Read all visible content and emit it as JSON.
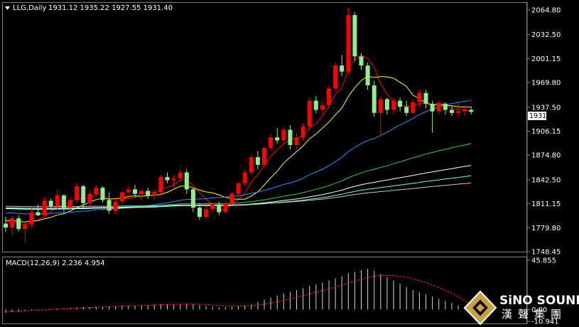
{
  "chart_data": {
    "type": "candlestick",
    "header": {
      "symbol": "LLG,Daily",
      "ohlc": "1931.12 1935.22 1927.55 1931.40"
    },
    "y_ticks": [
      "2064.80",
      "2032.50",
      "2001.15",
      "1969.80",
      "1937.50",
      "1906.15",
      "1874.80",
      "1842.50",
      "1811.15",
      "1779.80",
      "1748.45"
    ],
    "ylim": [
      1748.45,
      2074
    ],
    "current_price": "1931.40",
    "colors": {
      "up": "#ff0000",
      "down": "#90ee90",
      "ma_fast": "#ff0000",
      "ma_2": "#ffff00",
      "ma_3": "#1e90ff",
      "ma_4": "#2ecc40",
      "ma_5": "#ffffff",
      "ma_6": "#d8bfd8",
      "ma_7": "#7fffd4"
    },
    "candles": [
      [
        1785,
        1794,
        1774,
        1780
      ],
      [
        1780,
        1795,
        1770,
        1792
      ],
      [
        1792,
        1796,
        1775,
        1778
      ],
      [
        1778,
        1787,
        1760,
        1784
      ],
      [
        1784,
        1805,
        1780,
        1800
      ],
      [
        1800,
        1810,
        1795,
        1796
      ],
      [
        1796,
        1820,
        1794,
        1815
      ],
      [
        1815,
        1818,
        1805,
        1808
      ],
      [
        1808,
        1830,
        1804,
        1822
      ],
      [
        1822,
        1824,
        1800,
        1806
      ],
      [
        1806,
        1820,
        1802,
        1816
      ],
      [
        1816,
        1838,
        1812,
        1834
      ],
      [
        1834,
        1836,
        1806,
        1812
      ],
      [
        1812,
        1828,
        1808,
        1824
      ],
      [
        1824,
        1836,
        1820,
        1832
      ],
      [
        1832,
        1834,
        1813,
        1816
      ],
      [
        1816,
        1826,
        1798,
        1802
      ],
      [
        1802,
        1818,
        1798,
        1814
      ],
      [
        1814,
        1828,
        1810,
        1826
      ],
      [
        1826,
        1835,
        1818,
        1830
      ],
      [
        1830,
        1836,
        1820,
        1824
      ],
      [
        1824,
        1830,
        1815,
        1828
      ],
      [
        1828,
        1832,
        1818,
        1822
      ],
      [
        1822,
        1830,
        1816,
        1826
      ],
      [
        1826,
        1848,
        1822,
        1846
      ],
      [
        1846,
        1852,
        1838,
        1842
      ],
      [
        1842,
        1848,
        1832,
        1844
      ],
      [
        1844,
        1856,
        1840,
        1852
      ],
      [
        1852,
        1856,
        1824,
        1830
      ],
      [
        1830,
        1832,
        1800,
        1806
      ],
      [
        1806,
        1812,
        1790,
        1794
      ],
      [
        1794,
        1808,
        1790,
        1804
      ],
      [
        1804,
        1812,
        1798,
        1810
      ],
      [
        1810,
        1814,
        1796,
        1800
      ],
      [
        1800,
        1816,
        1798,
        1812
      ],
      [
        1812,
        1826,
        1810,
        1824
      ],
      [
        1824,
        1840,
        1820,
        1838
      ],
      [
        1838,
        1856,
        1834,
        1852
      ],
      [
        1852,
        1876,
        1848,
        1872
      ],
      [
        1872,
        1880,
        1856,
        1862
      ],
      [
        1862,
        1886,
        1858,
        1884
      ],
      [
        1884,
        1902,
        1880,
        1898
      ],
      [
        1898,
        1910,
        1890,
        1894
      ],
      [
        1894,
        1912,
        1888,
        1908
      ],
      [
        1908,
        1914,
        1882,
        1888
      ],
      [
        1888,
        1904,
        1882,
        1898
      ],
      [
        1898,
        1916,
        1894,
        1912
      ],
      [
        1912,
        1950,
        1906,
        1946
      ],
      [
        1946,
        1952,
        1930,
        1934
      ],
      [
        1934,
        1946,
        1928,
        1940
      ],
      [
        1940,
        1966,
        1936,
        1962
      ],
      [
        1962,
        1996,
        1958,
        1992
      ],
      [
        1992,
        2006,
        1978,
        1984
      ],
      [
        1984,
        2068,
        1980,
        2058
      ],
      [
        2058,
        2062,
        1998,
        2004
      ],
      [
        2004,
        2008,
        1986,
        1992
      ],
      [
        1992,
        1996,
        1960,
        1966
      ],
      [
        1966,
        1972,
        1925,
        1930
      ],
      [
        1930,
        1952,
        1900,
        1948
      ],
      [
        1948,
        1950,
        1928,
        1934
      ],
      [
        1934,
        1950,
        1928,
        1946
      ],
      [
        1946,
        1950,
        1932,
        1938
      ],
      [
        1938,
        1946,
        1926,
        1930
      ],
      [
        1930,
        1948,
        1928,
        1944
      ],
      [
        1944,
        1960,
        1938,
        1956
      ],
      [
        1956,
        1960,
        1936,
        1942
      ],
      [
        1942,
        1946,
        1904,
        1932
      ],
      [
        1932,
        1946,
        1928,
        1942
      ],
      [
        1942,
        1944,
        1928,
        1934
      ],
      [
        1934,
        1940,
        1926,
        1930
      ],
      [
        1930,
        1945,
        1925,
        1932
      ],
      [
        1932,
        1940,
        1926,
        1934
      ],
      [
        1934,
        1938,
        1928,
        1931.4
      ]
    ],
    "macd": {
      "label": "MACD(12,26,9) 2.236 4.954",
      "y_ticks": [
        "45.855",
        "0.00",
        "-10.941"
      ],
      "ylim": [
        -10.941,
        45.855
      ],
      "histogram": [
        -3,
        -2.5,
        -2,
        -1.5,
        -1,
        -0.5,
        0,
        0.5,
        1,
        1.2,
        1.5,
        2,
        2.2,
        2.4,
        2.6,
        2.8,
        3,
        3.2,
        3.4,
        3.6,
        3.8,
        4,
        4.2,
        4.5,
        4.8,
        5,
        5.2,
        5.4,
        5.6,
        5.2,
        4.2,
        3.2,
        2.6,
        2.2,
        2.2,
        2.6,
        3.2,
        4,
        5,
        7,
        9,
        11,
        13,
        15,
        16.5,
        18,
        20,
        22,
        23.5,
        25,
        27,
        29,
        31,
        33.5,
        35,
        36.5,
        38,
        36,
        33,
        30,
        27,
        24,
        21,
        18,
        16,
        14,
        12,
        10,
        8,
        6,
        4,
        2.4,
        2.236
      ],
      "signal": [
        -2,
        -1.8,
        -1.5,
        -1.2,
        -0.9,
        -0.6,
        -0.3,
        0,
        0.3,
        0.6,
        0.9,
        1.2,
        1.5,
        1.8,
        2.1,
        2.4,
        2.7,
        3,
        3.2,
        3.4,
        3.6,
        3.8,
        4,
        4.2,
        4.4,
        4.6,
        4.8,
        5,
        5.1,
        5.1,
        4.9,
        4.6,
        4.2,
        3.8,
        3.5,
        3.3,
        3.2,
        3.3,
        3.6,
        4.2,
        5,
        6,
        7.2,
        8.6,
        10,
        11.5,
        13,
        14.5,
        16,
        17.5,
        19.2,
        21,
        22.8,
        24.6,
        26.3,
        28,
        29.8,
        31,
        31.6,
        31.8,
        31.5,
        30.8,
        29.8,
        28.4,
        26.8,
        24.9,
        22.8,
        20.4,
        17.8,
        15,
        12,
        8.4,
        4.954
      ]
    }
  },
  "watermark": {
    "brand": "SiNO SOUND",
    "chinese": "漢聲集團"
  }
}
